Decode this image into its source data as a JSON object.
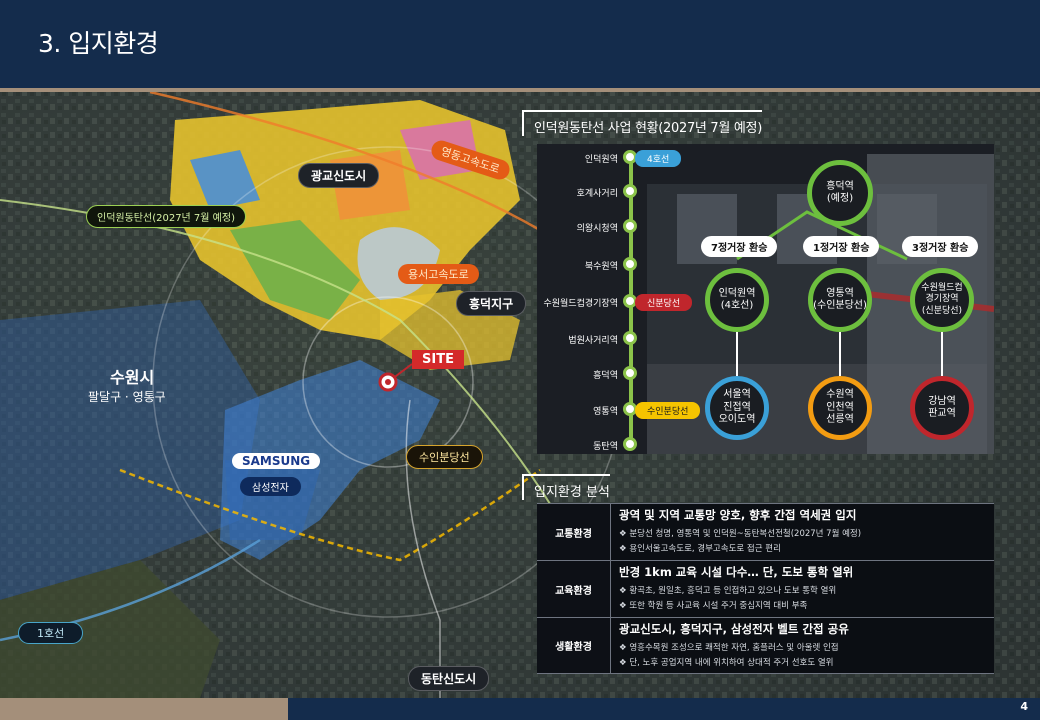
{
  "header": {
    "title": "3. 입지환경",
    "page_number": "4"
  },
  "map": {
    "labels": {
      "gwanggyo": "광교신도시",
      "yeongdong_expressway": "영동고속도로",
      "indeokwon_line": "인덕원동탄선(2027년 7월 예정)",
      "yongseo_expressway": "용서고속도로",
      "heungdeok": "흥덕지구",
      "site": "SITE",
      "suwon_city": "수원시",
      "suwon_districts": "팔달구 · 영통구",
      "samsung_logo": "SAMSUNG",
      "samsung": "삼성전자",
      "suin_bundang": "수인분당선",
      "line1": "1호선",
      "dongtan": "동탄신도시"
    }
  },
  "line_status": {
    "title": "인덕원동탄선 사업 현황(2027년 7월 예정)",
    "stations": [
      "인덕원역",
      "호계사거리",
      "의왕시청역",
      "북수원역",
      "수원월드컵경기장역",
      "법원사거리역",
      "흥덕역",
      "영통역",
      "동탄역"
    ],
    "tags": {
      "line4": "4호선",
      "sinbundang": "신분당선",
      "suinbundang": "수인분당선"
    },
    "hub": "흥덕역\n(예정)",
    "transfers": [
      "7정거장 환승",
      "1정거장 환승",
      "3정거장 환승"
    ],
    "mid_circles": [
      "인덕원역\n(4호선)",
      "영통역\n(수인분당선)",
      "수원월드컵\n경기장역\n(신분당선)"
    ],
    "destinations": [
      "서울역\n진접역\n오이도역",
      "수원역\n인천역\n선릉역",
      "강남역\n판교역"
    ]
  },
  "analysis": {
    "title": "입지환경 분석",
    "rows": [
      {
        "category": "교통환경",
        "headline": "광역 및 지역 교통망 양호, 향후 간접 역세권 입지",
        "bullets": [
          "❖ 분당선 청명, 영통역 및 인덕원~동탄복선전철(2027년 7월 예정)",
          "❖ 용인서울고속도로, 경부고속도로 접근 편리"
        ]
      },
      {
        "category": "교육환경",
        "headline": "반경 1km 교육 시설 다수… 단, 도보 통학 열위",
        "bullets": [
          "❖ 황곡초, 원일초, 흥덕고 등 인접하고 있으나 도보 통학 열위",
          "❖ 또한 학원 등 사교육 시설 주거 중심지역 대비 부족"
        ]
      },
      {
        "category": "생활환경",
        "headline": "광교신도시, 흥덕지구, 삼성전자 벨트 간접 공유",
        "bullets": [
          "❖ 영흥수목원 조성으로 쾌적한 자연, 홈플러스 및 아울렛 인접",
          "❖ 단, 노후 공업지역 내에 위치하여 상대적 주거 선호도 열위"
        ]
      }
    ]
  },
  "colors": {
    "header": "#142c4c",
    "accent": "#a48f7a",
    "line_green": "#8bc34a",
    "line4_blue": "#3aa0d8",
    "sinbundang_red": "#c0262c",
    "suinbundang_yellow": "#f5c400",
    "hub_green": "#6dbf3e",
    "orange": "#f39c12",
    "crimson": "#c0262c"
  }
}
